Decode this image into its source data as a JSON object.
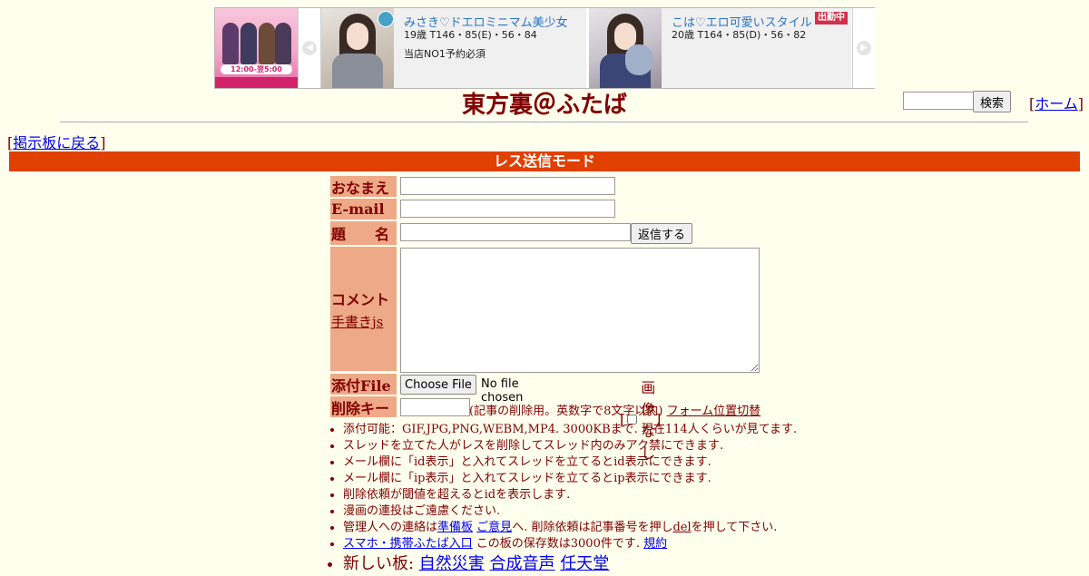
{
  "ad": {
    "shop_hours": "12:00-翌5:00",
    "prev_arrow": "◀",
    "next_arrow": "▶",
    "cards": [
      {
        "name": "みさき♡ドエロミニマム美少女",
        "stats": "19歳 T146・85(E)・56・84",
        "note": "当店NO1予約必須",
        "status": ""
      },
      {
        "name": "こは♡エロ可愛いスタイル",
        "stats": "20歳 T164・85(D)・56・82",
        "note": "",
        "status": "出勤中"
      }
    ]
  },
  "header": {
    "title": "東方裏＠ふたば",
    "search_button": "検索",
    "search_value": "",
    "home_link": "ホーム",
    "back_link": "掲示板に戻る"
  },
  "mode_banner": "レス送信モード",
  "form": {
    "name_label": "おなまえ",
    "email_label": "E-mail",
    "subject_label_a": "題",
    "subject_label_b": "名",
    "submit_button": "返信する",
    "comment_label": "コメント",
    "handwriting_link": "手書きjs",
    "file_label": "添付File",
    "file_button": "Choose File",
    "file_status": "No file chosen",
    "no_image_label": "画像なし",
    "delkey_label": "削除キー",
    "delkey_note": "(記事の削除用。英数字で8文字以内)",
    "form_position_link": "フォーム位置切替"
  },
  "notes": {
    "n1": "添付可能：GIF,JPG,PNG,WEBM,MP4. 3000KBまで. 現在114人くらいが見てます.",
    "n2": "スレッドを立てた人がレスを削除してスレッド内のみアク禁にできます.",
    "n3": "メール欄に「id表示」と入れてスレッドを立てるとid表示にできます.",
    "n4": "メール欄に「ip表示」と入れてスレッドを立てるとip表示にできます.",
    "n5": "削除依頼が閾値を超えるとidを表示します.",
    "n6": "漫画の連投はご遠慮ください.",
    "n7_pre": "管理人への連絡は",
    "n7_link1": "準備板",
    "n7_link2": "ご意見",
    "n7_mid": "へ. 削除依頼は記事番号を押し",
    "n7_link3": "del",
    "n7_post": "を押して下さい.",
    "n8_link1": "スマホ・携帯ふたば入口",
    "n8_mid": " この板の保存数は3000件です. ",
    "n8_link2": "規約",
    "n9_label": "新しい板: ",
    "n9_boards": [
      "自然災害",
      "合成音声",
      "任天堂"
    ]
  },
  "colors": {
    "background": "#ffffee",
    "text": "#800000",
    "banner": "#e04000",
    "label_bg": "#eeaa88",
    "link": "#0000ee"
  }
}
